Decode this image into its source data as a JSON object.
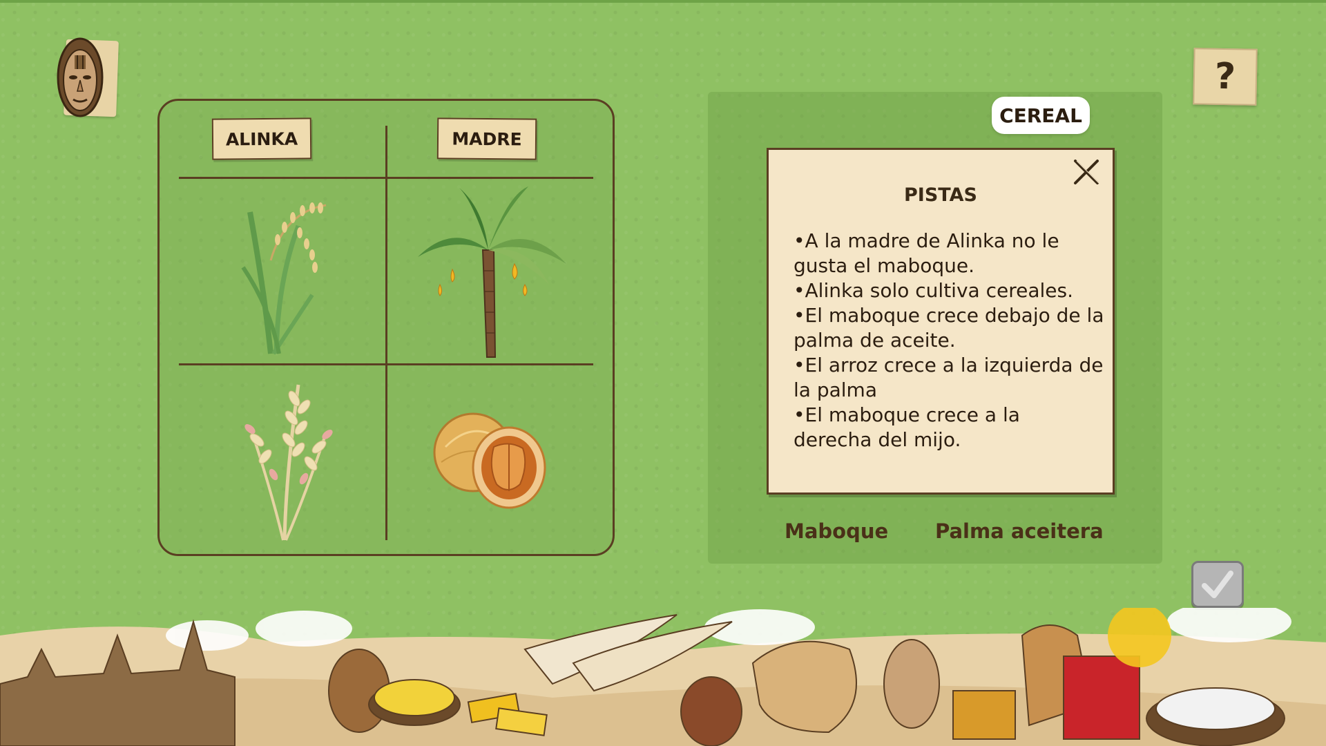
{
  "board": {
    "col1_label": "ALINKA",
    "col2_label": "MADRE",
    "cells": [
      {
        "row": 1,
        "col": 1,
        "icon": "rice-plant-icon"
      },
      {
        "row": 1,
        "col": 2,
        "icon": "oil-palm-icon"
      },
      {
        "row": 2,
        "col": 1,
        "icon": "millet-icon"
      },
      {
        "row": 2,
        "col": 2,
        "icon": "maboque-fruit-icon"
      }
    ]
  },
  "panel": {
    "category_tab": "CEREAL",
    "options": [
      "Maboque",
      "Palma aceitera"
    ]
  },
  "hints": {
    "title": "PISTAS",
    "items": [
      "•A la madre de Alinka no le gusta el maboque.",
      "•Alinka solo cultiva cereales.",
      "•El maboque crece debajo de la palma de aceite.",
      "•El arroz crece a la izquierda de la palma",
      "•El maboque crece a la derecha del mijo."
    ]
  },
  "buttons": {
    "help_label": "?",
    "profile_icon": "african-mask-icon",
    "close_icon": "close-icon",
    "check_icon": "checkmark-icon"
  },
  "colors": {
    "background": "#8fc163",
    "ink": "#5a3e22",
    "paper": "#f5e6c8"
  }
}
